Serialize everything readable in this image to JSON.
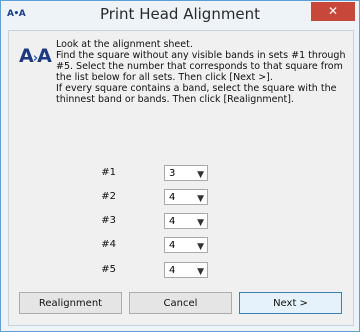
{
  "window": {
    "title": "Print Head Alignment",
    "app_icon_text": "A•A",
    "close_label": "✕"
  },
  "instructions": {
    "icon_text": "A",
    "icon_text_b": "A",
    "line1": "Look at the alignment sheet.",
    "line2": "Find the square without any visible bands in sets #1 through #5. Select the number that corresponds to that square from the list below for all sets. Then click [Next >].",
    "line3": "If every square contains a band, select the square with the thinnest band or bands. Then click [Realignment]."
  },
  "sets": [
    {
      "label": "#1",
      "value": "3"
    },
    {
      "label": "#2",
      "value": "4"
    },
    {
      "label": "#3",
      "value": "4"
    },
    {
      "label": "#4",
      "value": "4"
    },
    {
      "label": "#5",
      "value": "4"
    }
  ],
  "buttons": {
    "realignment": "Realignment",
    "cancel": "Cancel",
    "next": "Next >"
  },
  "colors": {
    "title_border": "#5e9fd8",
    "close": "#c7473a",
    "icon": "#1d3a80"
  }
}
